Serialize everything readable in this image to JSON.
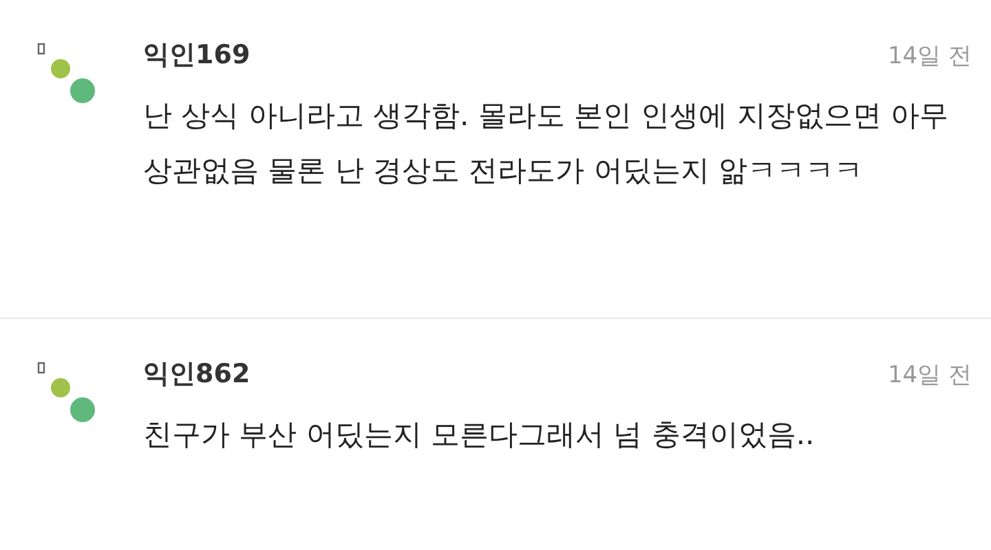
{
  "comments": [
    {
      "author": "익인169",
      "time": "14일 전",
      "text": "난 상식 아니라고 생각함. 몰라도 본인 인생에 지장없으면 아무 상관없음 물론 난 경상도 전라도가 어딨는지 앎ㅋㅋㅋㅋ"
    },
    {
      "author": "익인862",
      "time": "14일 전",
      "text": "친구가 부산 어딨는지 모른다그래서 넘 충격이었음.."
    }
  ]
}
